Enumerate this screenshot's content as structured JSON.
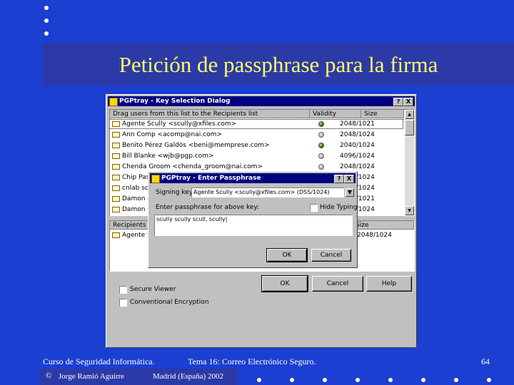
{
  "slide": {
    "title": "Petición de passphrase para la firma",
    "footer_course": "Curso de Seguridad Informática.",
    "footer_topic": "Tema 16: Correo Electrónico Seguro.",
    "page_number": "64",
    "author_symbol": "©",
    "author": "Jorge Ramió Aguirre",
    "place_year": "Madrid (España) 2002"
  },
  "dialog": {
    "title": "PGPtray - Key Selection Dialog",
    "help_btn": "?",
    "close_btn": "X",
    "columns": {
      "users": "Drag users from this list to the Recipients list",
      "validity": "Validity",
      "size": "Size"
    },
    "users": [
      {
        "name": "Agente Scully <scully@xfiles.com>",
        "validity": "green",
        "size": "2048/1021"
      },
      {
        "name": "Ann Comp <acomp@nai.com>",
        "validity": "gray",
        "size": "2048/1024"
      },
      {
        "name": "Benito Pérez Galdós <beni@memprese.com>",
        "validity": "green",
        "size": "2040/1024"
      },
      {
        "name": "Bill Blanke <wjb@pgp.com>",
        "validity": "gray",
        "size": "4096/1024"
      },
      {
        "name": "Chenda Groom <chenda_groom@nai.com>",
        "validity": "gray",
        "size": "2048/1024"
      },
      {
        "name": "Chip Pas",
        "validity": "gray",
        "size": "2048/1024"
      },
      {
        "name": "cnlab sof",
        "validity": "gray",
        "size": "2048/1024"
      },
      {
        "name": "Damon G",
        "validity": "gray",
        "size": "2048/1021"
      },
      {
        "name": "Damon G",
        "validity": "gray",
        "size": "2048/1024"
      }
    ],
    "recipients_header": "Recipients",
    "recipients_size_header": "Size",
    "recipients": [
      {
        "name": "Agente S",
        "size": "2048/1024"
      }
    ],
    "secure_viewer": "Secure Viewer",
    "conventional": "Conventional Encryption",
    "ok": "OK",
    "cancel": "Cancel",
    "help": "Help"
  },
  "passphrase": {
    "title": "PGPtray - Enter Passphrase",
    "help_btn": "?",
    "close_btn": "X",
    "signing_key_label": "Signing key:",
    "signing_key_value": "Agente Scully <scully@xfiles.com> (DSS/1024)",
    "prompt": "Enter passphrase for above key:",
    "hide_typing": "Hide Typing",
    "passphrase_value": "scully scully scull, scully|",
    "ok": "OK",
    "cancel": "Cancel"
  }
}
